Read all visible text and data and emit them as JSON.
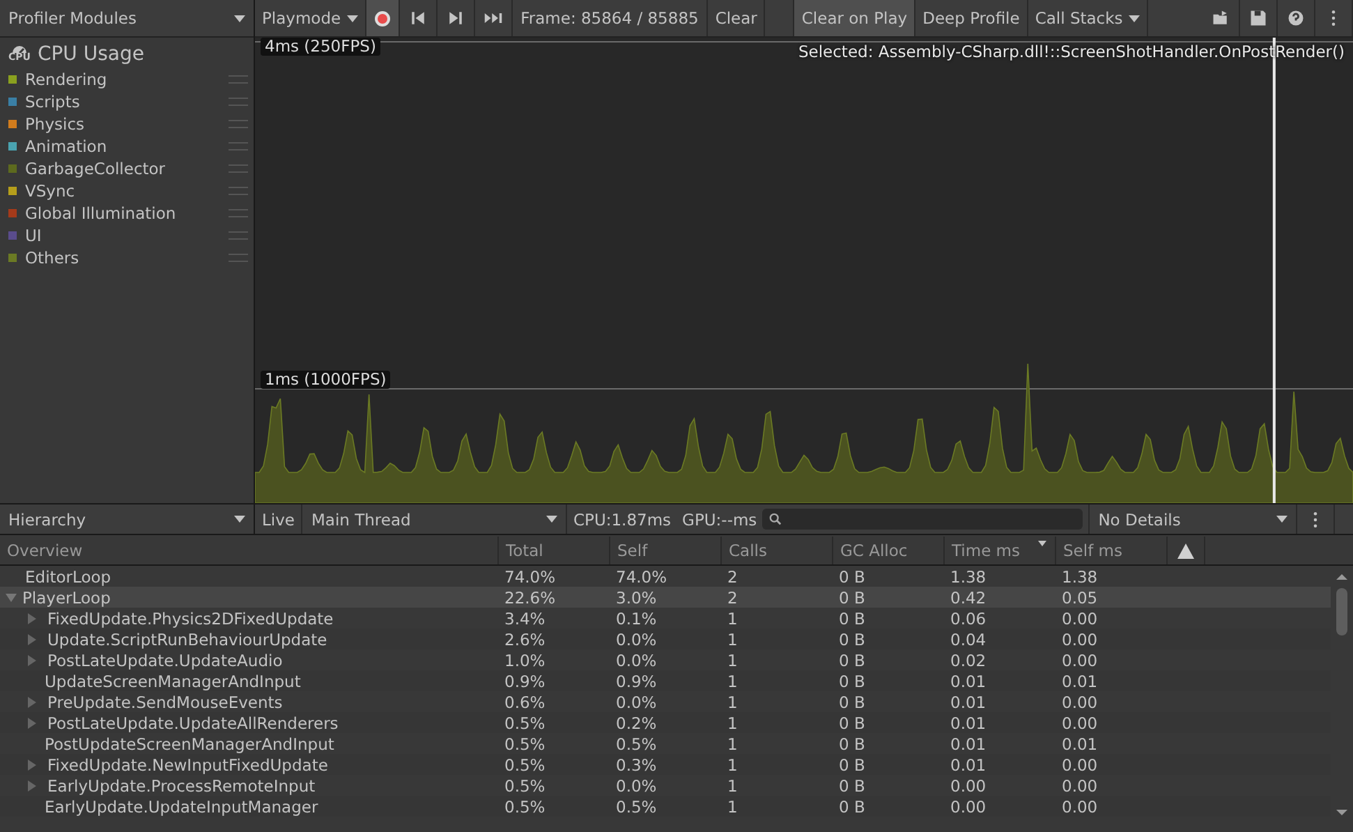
{
  "modules_dropdown": {
    "label": "Profiler Modules"
  },
  "toolbar": {
    "playmode": "Playmode",
    "record": {
      "on": true
    },
    "frame": "Frame: 85864 / 85885",
    "clear": "Clear",
    "toggles": [
      {
        "label": "Clear on Play",
        "selected": true
      },
      {
        "label": "Deep Profile",
        "selected": false
      }
    ],
    "call_stacks": "Call Stacks"
  },
  "module": {
    "title": "CPU Usage",
    "icon_text": "CPU",
    "legend": [
      {
        "label": "Rendering",
        "color": "#8aa01f"
      },
      {
        "label": "Scripts",
        "color": "#3a7fa5"
      },
      {
        "label": "Physics",
        "color": "#d17c1d"
      },
      {
        "label": "Animation",
        "color": "#4aa3b0"
      },
      {
        "label": "GarbageCollector",
        "color": "#5d6a1e"
      },
      {
        "label": "VSync",
        "color": "#b59e1b"
      },
      {
        "label": "Global Illumination",
        "color": "#a43a1a"
      },
      {
        "label": "UI",
        "color": "#5a4c8c"
      },
      {
        "label": "Others",
        "color": "#6b7a24"
      }
    ]
  },
  "chart": {
    "top_label": "4ms (250FPS)",
    "mid_label": "1ms (1000FPS)",
    "selected": "Selected: Assembly-CSharp.dll!::ScreenShotHandler.OnPostRender()"
  },
  "details_bar": {
    "view": "Hierarchy",
    "live": "Live",
    "thread": "Main Thread",
    "cpu": "CPU:1.87ms",
    "gpu": "GPU:--ms",
    "details": "No Details"
  },
  "table": {
    "columns": [
      {
        "label": "Overview",
        "sorted": false
      },
      {
        "label": "Total",
        "sorted": false
      },
      {
        "label": "Self",
        "sorted": false
      },
      {
        "label": "Calls",
        "sorted": false
      },
      {
        "label": "GC Alloc",
        "sorted": false
      },
      {
        "label": "Time ms",
        "sorted": true
      },
      {
        "label": "Self ms",
        "sorted": false
      }
    ],
    "rows": [
      {
        "kind": "leaf",
        "selected": false,
        "cells": [
          "EditorLoop",
          "74.0%",
          "74.0%",
          "2",
          "0 B",
          "1.38",
          "1.38"
        ]
      },
      {
        "kind": "group",
        "expanded": true,
        "selected": true,
        "cells": [
          "PlayerLoop",
          "22.6%",
          "3.0%",
          "2",
          "0 B",
          "0.42",
          "0.05"
        ],
        "children": [
          {
            "kind": "group",
            "expanded": false,
            "selected": false,
            "cells": [
              "FixedUpdate.Physics2DFixedUpdate",
              "3.4%",
              "0.1%",
              "1",
              "0 B",
              "0.06",
              "0.00"
            ]
          },
          {
            "kind": "group",
            "expanded": false,
            "selected": false,
            "cells": [
              "Update.ScriptRunBehaviourUpdate",
              "2.6%",
              "0.0%",
              "1",
              "0 B",
              "0.04",
              "0.00"
            ]
          },
          {
            "kind": "group",
            "expanded": false,
            "selected": false,
            "cells": [
              "PostLateUpdate.UpdateAudio",
              "1.0%",
              "0.0%",
              "1",
              "0 B",
              "0.02",
              "0.00"
            ]
          },
          {
            "kind": "leaf",
            "selected": false,
            "cells": [
              "UpdateScreenManagerAndInput",
              "0.9%",
              "0.9%",
              "1",
              "0 B",
              "0.01",
              "0.01"
            ]
          },
          {
            "kind": "group",
            "expanded": false,
            "selected": false,
            "cells": [
              "PreUpdate.SendMouseEvents",
              "0.6%",
              "0.0%",
              "1",
              "0 B",
              "0.01",
              "0.00"
            ]
          },
          {
            "kind": "group",
            "expanded": false,
            "selected": false,
            "cells": [
              "PostLateUpdate.UpdateAllRenderers",
              "0.5%",
              "0.2%",
              "1",
              "0 B",
              "0.01",
              "0.00"
            ]
          },
          {
            "kind": "leaf",
            "selected": false,
            "cells": [
              "PostUpdateScreenManagerAndInput",
              "0.5%",
              "0.5%",
              "1",
              "0 B",
              "0.01",
              "0.01"
            ]
          },
          {
            "kind": "group",
            "expanded": false,
            "selected": false,
            "cells": [
              "FixedUpdate.NewInputFixedUpdate",
              "0.5%",
              "0.3%",
              "1",
              "0 B",
              "0.01",
              "0.00"
            ]
          },
          {
            "kind": "group",
            "expanded": false,
            "selected": false,
            "cells": [
              "EarlyUpdate.ProcessRemoteInput",
              "0.5%",
              "0.0%",
              "1",
              "0 B",
              "0.00",
              "0.00"
            ]
          },
          {
            "kind": "leaf",
            "selected": false,
            "cells": [
              "EarlyUpdate.UpdateInputManager",
              "0.5%",
              "0.5%",
              "1",
              "0 B",
              "0.00",
              "0.00"
            ]
          }
        ]
      }
    ]
  }
}
